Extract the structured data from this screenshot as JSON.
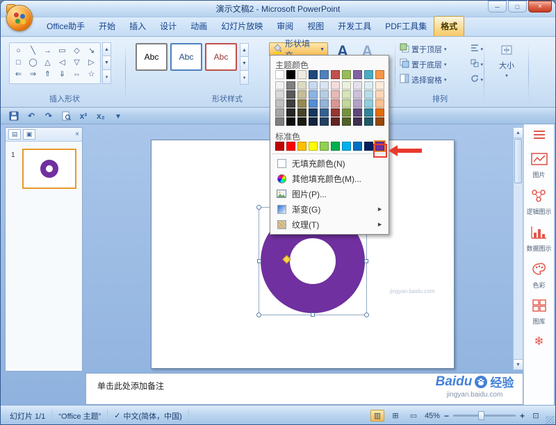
{
  "window": {
    "title": "演示文稿2 - Microsoft PowerPoint",
    "controls": {
      "minimize": "─",
      "maximize": "□",
      "close": "×"
    }
  },
  "ribbon": {
    "tabs": [
      {
        "label": "Office助手",
        "active": false
      },
      {
        "label": "开始",
        "active": false
      },
      {
        "label": "插入",
        "active": false
      },
      {
        "label": "设计",
        "active": false
      },
      {
        "label": "动画",
        "active": false
      },
      {
        "label": "幻灯片放映",
        "active": false
      },
      {
        "label": "审阅",
        "active": false
      },
      {
        "label": "视图",
        "active": false
      },
      {
        "label": "开发工具",
        "active": false
      },
      {
        "label": "PDF工具集",
        "active": false
      },
      {
        "label": "格式",
        "active": true
      }
    ],
    "groups": {
      "insert_shapes": {
        "label": "插入形状",
        "shape_rows": [
          [
            "○",
            "╲",
            "→",
            "▭",
            "◇",
            "↘"
          ],
          [
            "□",
            "◯",
            "△",
            "◁",
            "▽",
            "▷"
          ],
          [
            "⇐",
            "⇒",
            "⇑",
            "⇓",
            "⇔",
            "☆"
          ]
        ]
      },
      "shape_styles": {
        "label": "形状样式",
        "previews": [
          {
            "text": "Abc",
            "border": "#7f7f7f",
            "color": "#000000"
          },
          {
            "text": "Abc",
            "border": "#4f81bd",
            "color": "#1f497d"
          },
          {
            "text": "Abc",
            "border": "#c0504d",
            "color": "#943634"
          }
        ],
        "fill_button": {
          "label": "形状填充"
        }
      },
      "wordart": {
        "letters": [
          "A",
          "A"
        ]
      },
      "arrange": {
        "label": "排列",
        "items": [
          {
            "name": "bring-front",
            "label": "置于顶层",
            "icon": "bring-front",
            "mini": "align"
          },
          {
            "name": "send-back",
            "label": "置于底层",
            "icon": "send-back",
            "mini": "group-objects"
          },
          {
            "name": "selection-pane",
            "label": "选择窗格",
            "icon": "selection-pane",
            "mini": "rotate"
          }
        ]
      },
      "size": {
        "label": "大小"
      }
    }
  },
  "qat": {
    "undo": "↶",
    "redo": "↷",
    "superscript": "x²",
    "subscript": "x₂",
    "more": "▾"
  },
  "fill_menu": {
    "theme_label": "主题颜色",
    "standard_label": "标准色",
    "theme_colors": [
      "#FFFFFF",
      "#000000",
      "#EEECE1",
      "#1F497D",
      "#4F81BD",
      "#C0504D",
      "#9BBB59",
      "#8064A2",
      "#4BACC6",
      "#F79646"
    ],
    "theme_variants": [
      [
        "#F2F2F2",
        "#D8D8D8",
        "#BFBFBF",
        "#A5A5A5",
        "#7F7F7F"
      ],
      [
        "#7F7F7F",
        "#595959",
        "#3F3F3F",
        "#262626",
        "#0C0C0C"
      ],
      [
        "#DDD9C3",
        "#C4BD97",
        "#938953",
        "#494429",
        "#1D1B10"
      ],
      [
        "#C6D9F0",
        "#8DB3E2",
        "#548DD4",
        "#17365D",
        "#0F243E"
      ],
      [
        "#DBE5F1",
        "#B8CCE4",
        "#95B3D7",
        "#366092",
        "#244061"
      ],
      [
        "#F2DCDB",
        "#E5B9B7",
        "#D99694",
        "#943634",
        "#632423"
      ],
      [
        "#EBF1DD",
        "#D7E3BC",
        "#C3D69B",
        "#76923C",
        "#4F6128"
      ],
      [
        "#E5DFEC",
        "#CCC1D9",
        "#B2A2C7",
        "#5F497A",
        "#3F3151"
      ],
      [
        "#DBEEF3",
        "#B7DDE8",
        "#92CDDC",
        "#31859B",
        "#205867"
      ],
      [
        "#FDEADA",
        "#FBD5B5",
        "#FAC08F",
        "#E36C09",
        "#974806"
      ]
    ],
    "standard_colors": [
      "#C00000",
      "#FF0000",
      "#FFC000",
      "#FFFF00",
      "#92D050",
      "#00B050",
      "#00B0F0",
      "#0070C0",
      "#002060",
      "#7030A0"
    ],
    "selected_standard_index": 9,
    "items": [
      {
        "label": "无填充颜色(N)",
        "icon": "no-fill",
        "submenu": false
      },
      {
        "label": "其他填充颜色(M)...",
        "icon": "color-wheel",
        "submenu": false
      },
      {
        "label": "图片(P)...",
        "icon": "picture",
        "submenu": false
      },
      {
        "label": "渐变(G)",
        "icon": "gradient",
        "submenu": true
      },
      {
        "label": "纹理(T)",
        "icon": "texture",
        "submenu": true
      }
    ]
  },
  "slides_panel": {
    "slide_number": "1"
  },
  "slide": {
    "shape_fill": "#7030A0"
  },
  "notes": {
    "placeholder": "单击此处添加备注"
  },
  "sidebar": {
    "items": [
      {
        "icon": "menu",
        "label": ""
      },
      {
        "icon": "picture-chart",
        "label": "图片"
      },
      {
        "icon": "logic-diagram",
        "label": "逻辑图示"
      },
      {
        "icon": "data-chart",
        "label": "数据图示"
      },
      {
        "icon": "palette",
        "label": "色彩"
      },
      {
        "icon": "gallery",
        "label": "图库"
      },
      {
        "icon": "snowflake",
        "label": ""
      }
    ]
  },
  "status_bar": {
    "slide_indicator": "幻灯片 1/1",
    "theme_name": "“Office 主题”",
    "language": "中文(简体，中国)",
    "zoom": "45%"
  },
  "watermark": {
    "brand": "Baidu",
    "suffix": "经验",
    "url": "jingyan.baidu.com"
  },
  "colors": {
    "accent_purple": "#7030A0",
    "annotation_red": "#e8392e",
    "highlight_orange": "#f6c965"
  }
}
